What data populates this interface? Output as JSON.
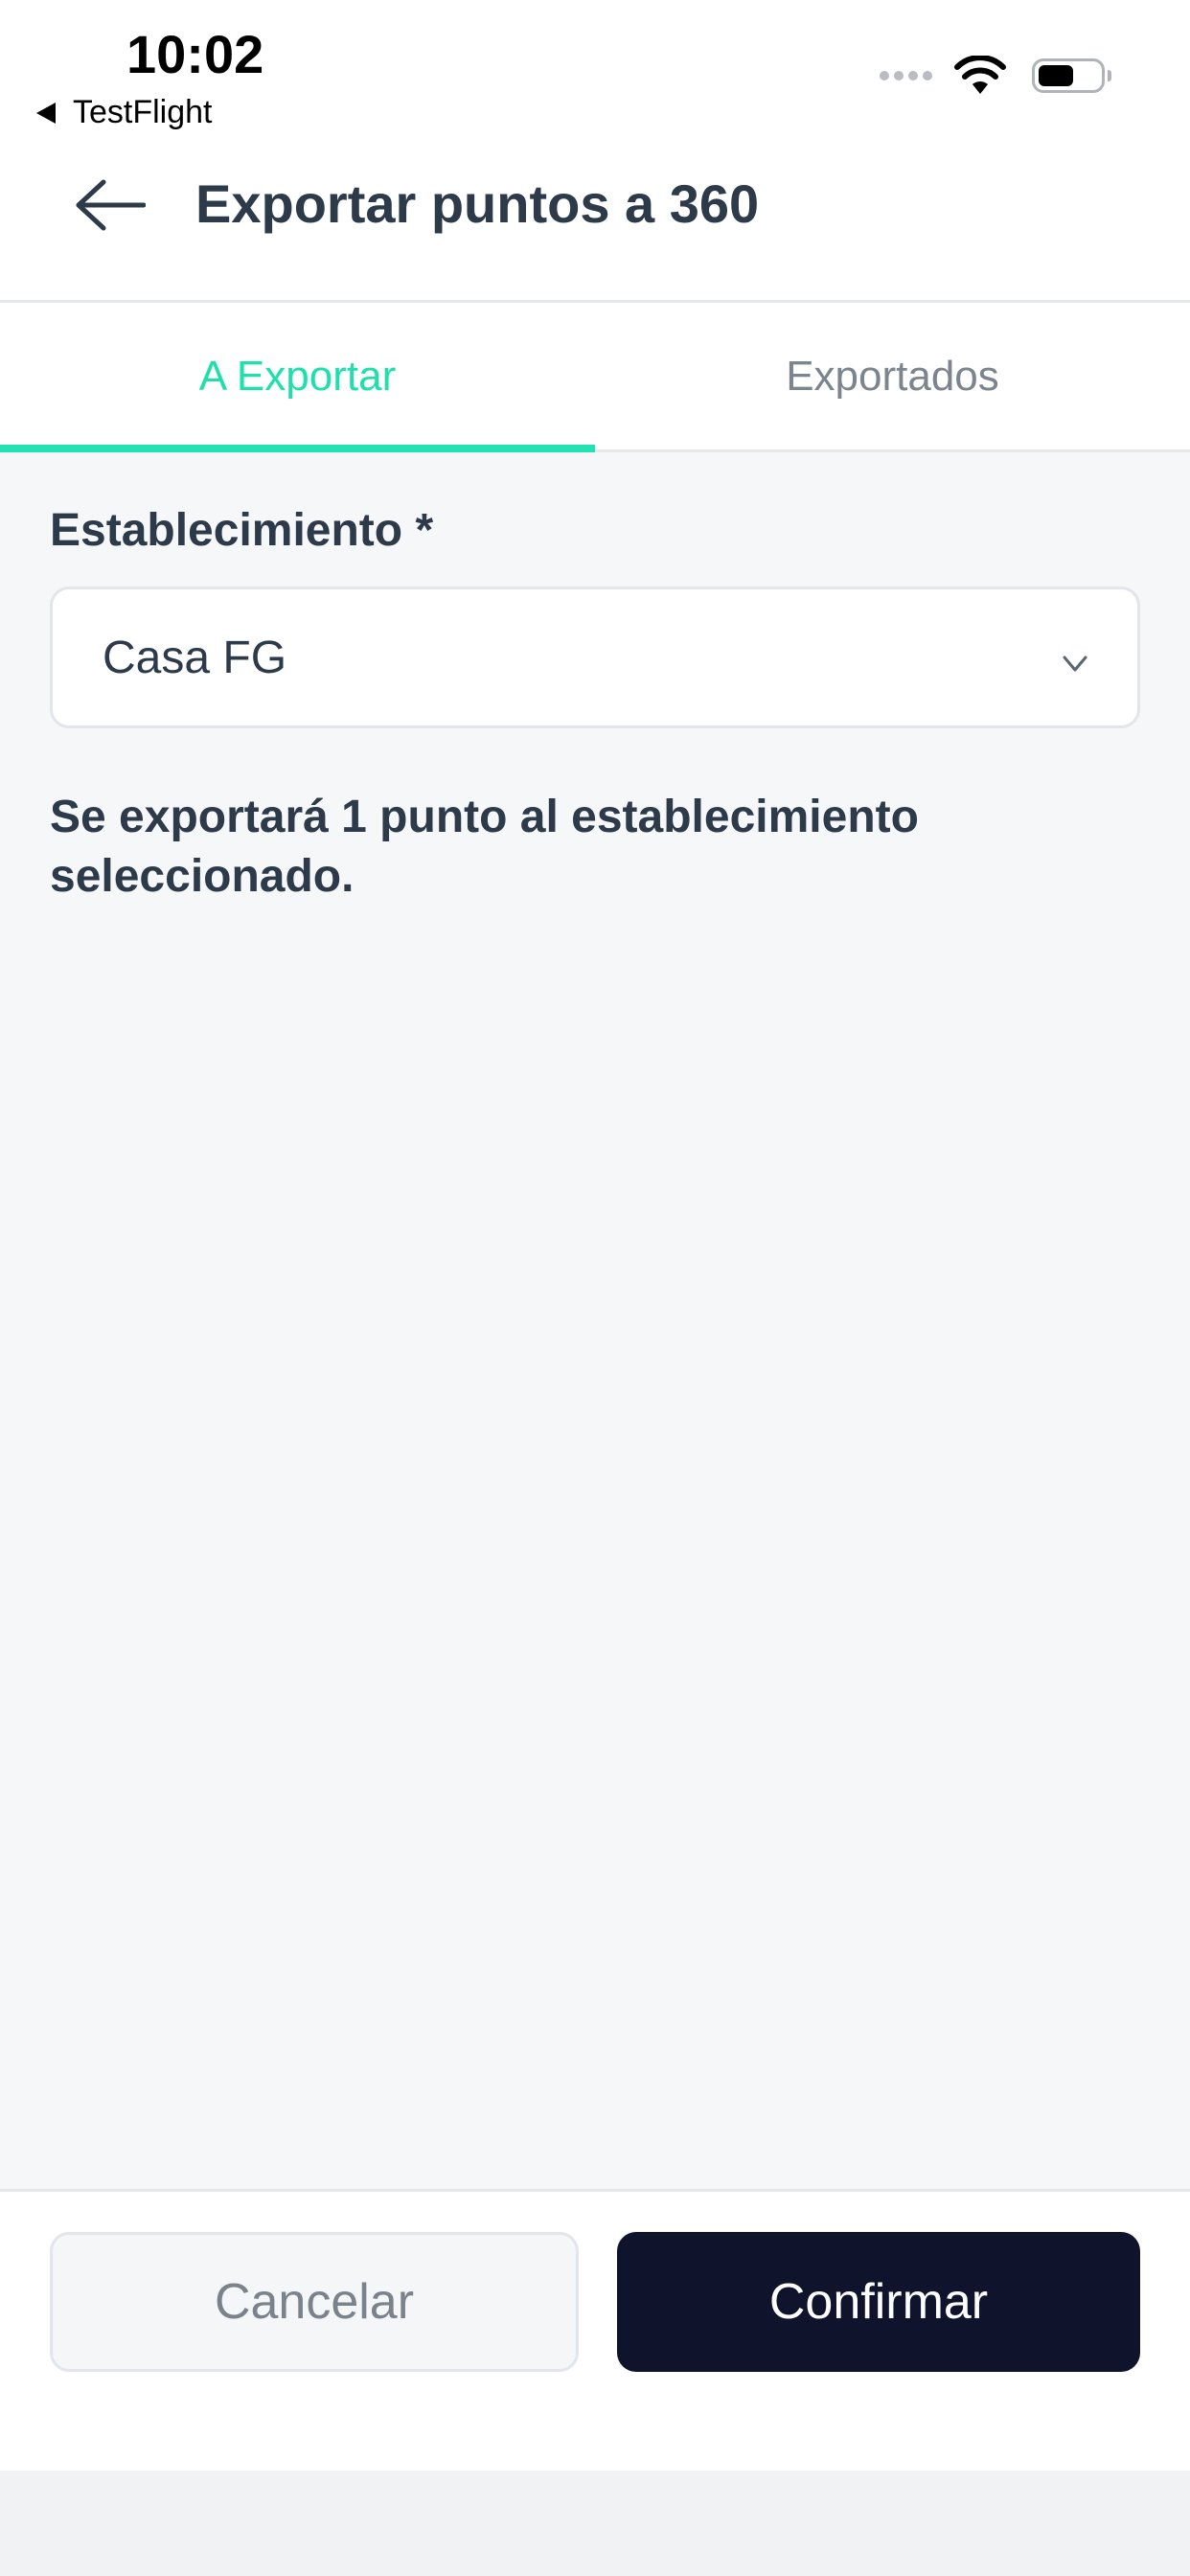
{
  "status_bar": {
    "time": "10:02",
    "back_app": "TestFlight",
    "icons": [
      "signal-icon",
      "wifi-icon",
      "battery-icon"
    ]
  },
  "header": {
    "title": "Exportar puntos a 360",
    "back_icon": "arrow-left-icon"
  },
  "tabs": [
    {
      "label": "A Exportar",
      "active": true
    },
    {
      "label": "Exportados",
      "active": false
    }
  ],
  "form": {
    "establishment_label": "Establecimiento *",
    "establishment_value": "Casa FG",
    "chevron_icon": "chevron-down-icon"
  },
  "info_text": "Se exportará 1 punto al establecimiento seleccionado.",
  "footer": {
    "cancel_label": "Cancelar",
    "confirm_label": "Confirmar"
  },
  "colors": {
    "accent": "#21e3b1",
    "primary_button": "#0f132b",
    "text": "#2d3a4a",
    "background": "#f6f7f9"
  }
}
